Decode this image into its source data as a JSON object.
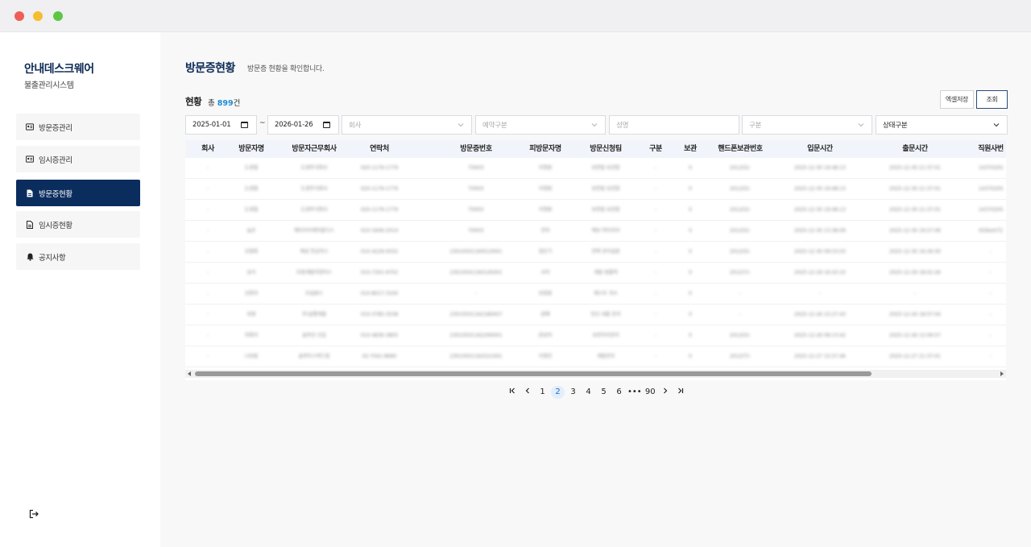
{
  "sidebar": {
    "brand_title": "안내데스크웨어",
    "brand_subtitle": "불출관리시스템",
    "items": [
      {
        "label": "방문증관리",
        "icon": "id-card-icon"
      },
      {
        "label": "임시증관리",
        "icon": "id-card-icon"
      },
      {
        "label": "방문증현황",
        "icon": "document-icon",
        "active": true
      },
      {
        "label": "임시증현황",
        "icon": "document-icon"
      },
      {
        "label": "공지사항",
        "icon": "bell-icon"
      }
    ],
    "logout_icon": "logout-icon"
  },
  "page": {
    "title": "방문증현황",
    "description": "방문증 현황을 확인합니다.",
    "section_title": "현황",
    "count_prefix": "총",
    "count_value": "899",
    "count_suffix": "건"
  },
  "buttons": {
    "excel": "엑셀저장",
    "search": "조회"
  },
  "filters": {
    "date_from": "2025-01-01",
    "date_to": "2026-01-26",
    "date_separator": "~",
    "company_placeholder": "회사",
    "reservation_placeholder": "예약구분",
    "name_placeholder": "성명",
    "type_placeholder": "구분",
    "status_placeholder": "상태구분"
  },
  "table": {
    "columns": [
      "회사",
      "방문자명",
      "방문자근무회사",
      "연락처",
      "방문증번호",
      "피방문자명",
      "방문신청팀",
      "구분",
      "보관",
      "핸드폰보관번호",
      "입문시간",
      "출문시간",
      "직원사번"
    ],
    "rows": [
      [
        "-",
        "도경철",
        "도경주식회사",
        "020-1179-1779",
        "T0003",
        "이형원",
        "보안팀 보관함",
        "-",
        "0",
        "2012(S)-",
        "2025-12-30 19:48:13",
        "2025-12-30 21:37:01",
        "1437020S"
      ],
      [
        "-",
        "도경철",
        "도경주식회사",
        "020-1179-1779",
        "T0003",
        "이형원",
        "보안팀 보관함",
        "-",
        "0",
        "2012(S)-",
        "2025-12-30 19:48:13",
        "2025-12-30 21:37:01",
        "1437020S"
      ],
      [
        "-",
        "도경철",
        "도경주식회사",
        "020-1179-1779",
        "T0003",
        "이형원",
        "보안팀 보관함",
        "-",
        "0",
        "2012(S)-",
        "2025-12-30 19:48:13",
        "2025-12-30 21:37:01",
        "1437020S"
      ],
      [
        "-",
        "늘은",
        "에티아이케미칼디스",
        "010-3406-2014",
        "T0003",
        "전자",
        "해보 머티리어",
        "-",
        "0",
        "2012(S)-",
        "2025-12-30 13:38:09",
        "2025-12-30 19:27:06",
        "ISOboH72"
      ],
      [
        "-",
        "선영화",
        "해성 연금하스",
        "010-4229-0032",
        "23010501160510001",
        "정은기",
        "언택 관리실원",
        "-",
        "0",
        "2012(S)-",
        "2025-12-30 09:53:03",
        "2025-12-30 16:29:30",
        "-"
      ],
      [
        "-",
        "송이",
        "모범개발자형하스",
        "010-7301-9702",
        "23010501160145001",
        "사라",
        "개발 원울력",
        "-",
        "0",
        "2012(Y)-",
        "2025-12-29 16:43:10",
        "2025-12-29 18:02:26",
        "-"
      ],
      [
        "-",
        "선현라",
        "모실원스",
        "010-8017-3100",
        "-",
        "보링원",
        "에스트 과소",
        "-",
        "0",
        "-",
        "-",
        "-",
        "-"
      ],
      [
        "-",
        "위영",
        "주)실행개발",
        "010-3785-3538",
        "23010501162180007",
        "완매",
        "인신 내을 관리",
        "-",
        "0",
        "-",
        "2025-12-26 15:27:43",
        "2025-12-26 18:07:04",
        "-"
      ],
      [
        "-",
        "저화야",
        "솔루션 신입",
        "010-4836-3805",
        "23010501162290001",
        "윤묘미",
        "보안미리관리",
        "-",
        "0",
        "2012(S)-",
        "2025-12-26 08:13:42",
        "2025-12-26 12:09:57",
        "-"
      ],
      [
        "-",
        "나보람",
        "솔루트스락드컴",
        "02-7041-8660",
        "23010501162521001",
        "이정민",
        "개발관리",
        "-",
        "0",
        "2012(T)-",
        "2025-12-27 15:57:46",
        "2025-12-27 21:37:01",
        "-"
      ]
    ]
  },
  "pagination": {
    "first_icon": "first-page-icon",
    "prev_icon": "prev-page-icon",
    "pages": [
      "1",
      "2",
      "3",
      "4",
      "5",
      "6"
    ],
    "current": "2",
    "ellipsis": "•••",
    "last_page": "90",
    "next_icon": "next-page-icon",
    "last_icon": "last-page-icon"
  }
}
